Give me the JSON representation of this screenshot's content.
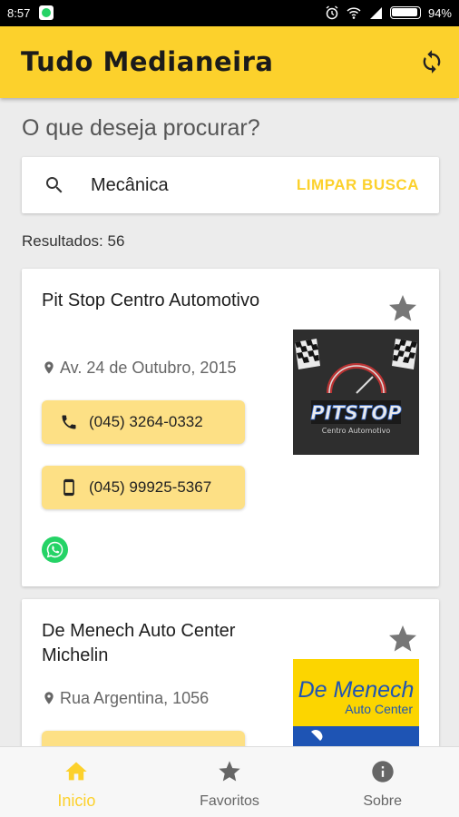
{
  "status_bar": {
    "time": "8:57",
    "battery": "94%"
  },
  "app": {
    "title": "Tudo Medianeira",
    "refresh_icon": "refresh-icon",
    "accent": "#fcd12c"
  },
  "search": {
    "prompt": "O que deseja procurar?",
    "value": "Mecânica",
    "clear_label": "LIMPAR BUSCA",
    "results_label": "Resultados: 56"
  },
  "results": [
    {
      "name": "Pit Stop Centro Automotivo",
      "address": "Av. 24 de Outubro, 2015",
      "phone": "(045) 3264-0332",
      "mobile": "(045) 99925-5367",
      "has_whatsapp": true,
      "logo_text": "PITSTOP",
      "logo_subtext": "Centro Automotivo"
    },
    {
      "name": "De Menech Auto Center Michelin",
      "address": "Rua Argentina, 1056",
      "logo_text": "De Menech",
      "logo_subtext": "Auto Center"
    }
  ],
  "nav": [
    {
      "label": "Inicio",
      "icon": "home-icon",
      "active": true
    },
    {
      "label": "Favoritos",
      "icon": "star-icon",
      "active": false
    },
    {
      "label": "Sobre",
      "icon": "info-icon",
      "active": false
    }
  ]
}
